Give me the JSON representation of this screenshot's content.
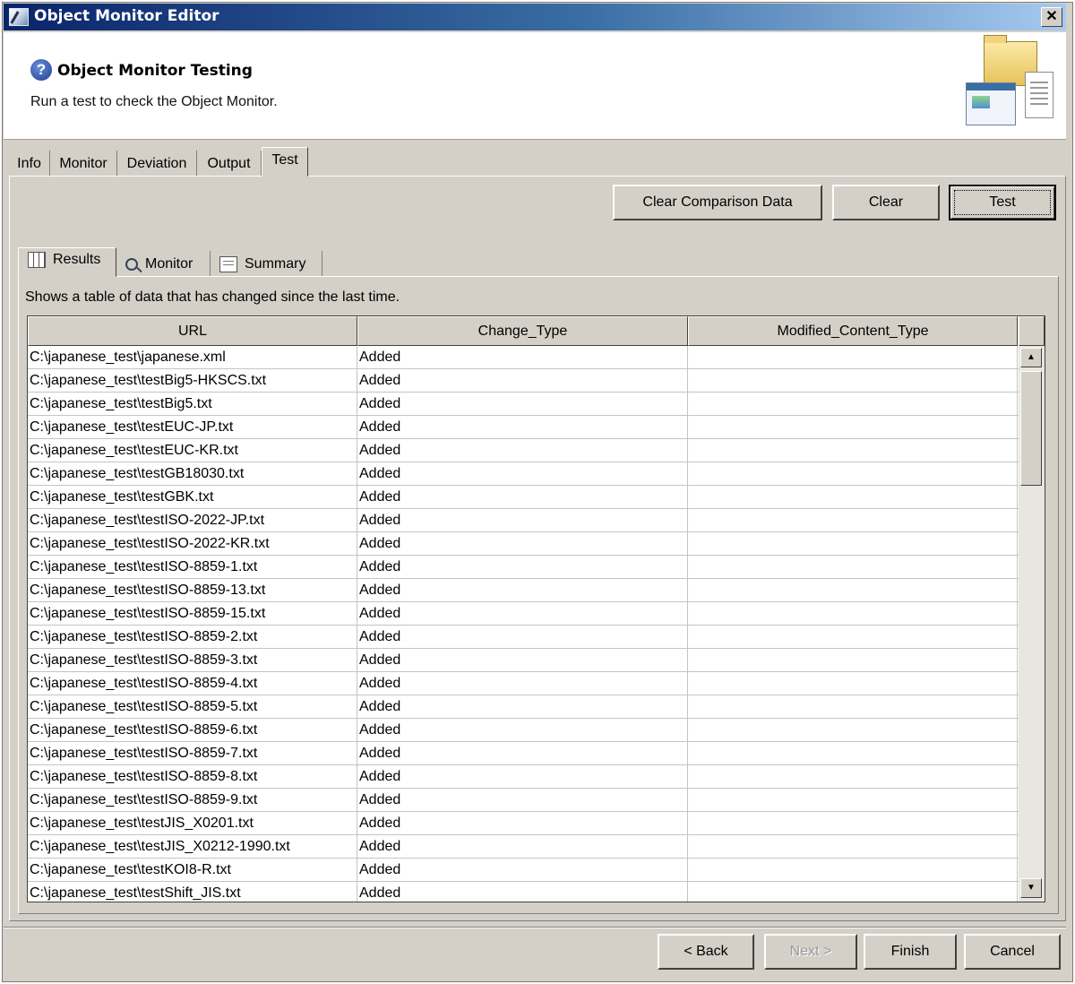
{
  "window": {
    "title": "Object Monitor Editor",
    "close_label": "✕"
  },
  "header": {
    "title": "Object Monitor Testing",
    "subtitle": "Run a test to check the Object Monitor."
  },
  "tabs": [
    "Info",
    "Monitor",
    "Deviation",
    "Output",
    "Test"
  ],
  "active_tab": "Test",
  "actions": {
    "clear_comparison": "Clear Comparison Data",
    "clear": "Clear",
    "test": "Test"
  },
  "subtabs": [
    "Results",
    "Monitor",
    "Summary"
  ],
  "active_subtab": "Results",
  "results": {
    "description": "Shows a table of data that has changed since the last time.",
    "columns": [
      "URL",
      "Change_Type",
      "Modified_Content_Type"
    ],
    "rows": [
      [
        "C:\\japanese_test\\japanese.xml",
        "Added",
        ""
      ],
      [
        "C:\\japanese_test\\testBig5-HKSCS.txt",
        "Added",
        ""
      ],
      [
        "C:\\japanese_test\\testBig5.txt",
        "Added",
        ""
      ],
      [
        "C:\\japanese_test\\testEUC-JP.txt",
        "Added",
        ""
      ],
      [
        "C:\\japanese_test\\testEUC-KR.txt",
        "Added",
        ""
      ],
      [
        "C:\\japanese_test\\testGB18030.txt",
        "Added",
        ""
      ],
      [
        "C:\\japanese_test\\testGBK.txt",
        "Added",
        ""
      ],
      [
        "C:\\japanese_test\\testISO-2022-JP.txt",
        "Added",
        ""
      ],
      [
        "C:\\japanese_test\\testISO-2022-KR.txt",
        "Added",
        ""
      ],
      [
        "C:\\japanese_test\\testISO-8859-1.txt",
        "Added",
        ""
      ],
      [
        "C:\\japanese_test\\testISO-8859-13.txt",
        "Added",
        ""
      ],
      [
        "C:\\japanese_test\\testISO-8859-15.txt",
        "Added",
        ""
      ],
      [
        "C:\\japanese_test\\testISO-8859-2.txt",
        "Added",
        ""
      ],
      [
        "C:\\japanese_test\\testISO-8859-3.txt",
        "Added",
        ""
      ],
      [
        "C:\\japanese_test\\testISO-8859-4.txt",
        "Added",
        ""
      ],
      [
        "C:\\japanese_test\\testISO-8859-5.txt",
        "Added",
        ""
      ],
      [
        "C:\\japanese_test\\testISO-8859-6.txt",
        "Added",
        ""
      ],
      [
        "C:\\japanese_test\\testISO-8859-7.txt",
        "Added",
        ""
      ],
      [
        "C:\\japanese_test\\testISO-8859-8.txt",
        "Added",
        ""
      ],
      [
        "C:\\japanese_test\\testISO-8859-9.txt",
        "Added",
        ""
      ],
      [
        "C:\\japanese_test\\testJIS_X0201.txt",
        "Added",
        ""
      ],
      [
        "C:\\japanese_test\\testJIS_X0212-1990.txt",
        "Added",
        ""
      ],
      [
        "C:\\japanese_test\\testKOI8-R.txt",
        "Added",
        ""
      ],
      [
        "C:\\japanese_test\\testShift_JIS.txt",
        "Added",
        ""
      ]
    ]
  },
  "nav": {
    "back": "< Back",
    "next": "Next >",
    "finish": "Finish",
    "cancel": "Cancel"
  },
  "icons": {
    "app": "app-window-icon",
    "help": "help-icon",
    "banner": "folder-documents-icon",
    "results": "table-icon",
    "monitor": "search-icon",
    "summary": "summary-icon"
  },
  "colors": {
    "titlebar_start": "#0a246a",
    "titlebar_end": "#a6caf0",
    "dialog_face": "#d4d0c8"
  }
}
